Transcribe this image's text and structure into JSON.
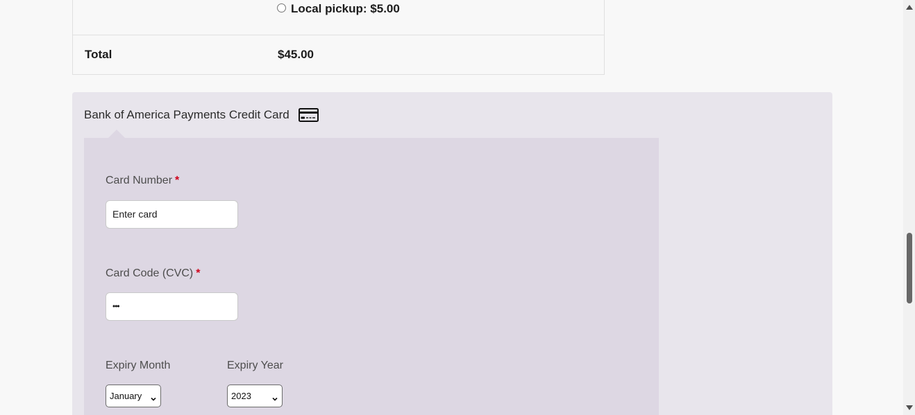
{
  "order_totals": {
    "shipping_option": "Local pickup: $5.00",
    "total_label": "Total",
    "total_value": "$45.00"
  },
  "payment": {
    "title": "Bank of America Payments Credit Card",
    "card_icon": "credit-card-icon",
    "card_number": {
      "label": "Card Number",
      "required_mark": "*",
      "value": "Enter card"
    },
    "card_code": {
      "label": "Card Code (CVC)",
      "required_mark": "*",
      "value": "•••"
    },
    "expiry_month": {
      "label": "Expiry Month",
      "selected": "January"
    },
    "expiry_year": {
      "label": "Expiry Year",
      "selected": "2023"
    }
  },
  "colors": {
    "payment_box_bg": "#e8e5ec",
    "payment_inner_bg": "#ddd7e3",
    "required": "#d0021b"
  }
}
